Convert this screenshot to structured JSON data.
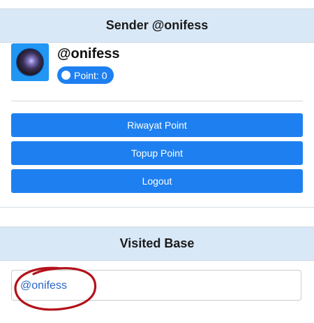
{
  "sender": {
    "header_title": "Sender @onifess",
    "username": "@onifess",
    "point_label": "Point: 0",
    "buttons": {
      "riwayat": "Riwayat Point",
      "topup": "Topup Point",
      "logout": "Logout"
    }
  },
  "visited": {
    "header_title": "Visited Base",
    "items": [
      {
        "label": "@onifess"
      }
    ]
  },
  "colors": {
    "accent": "#1e80f0",
    "header_bg": "#d9e8f7",
    "link": "#2a64c5",
    "annotation": "#b3121b"
  }
}
